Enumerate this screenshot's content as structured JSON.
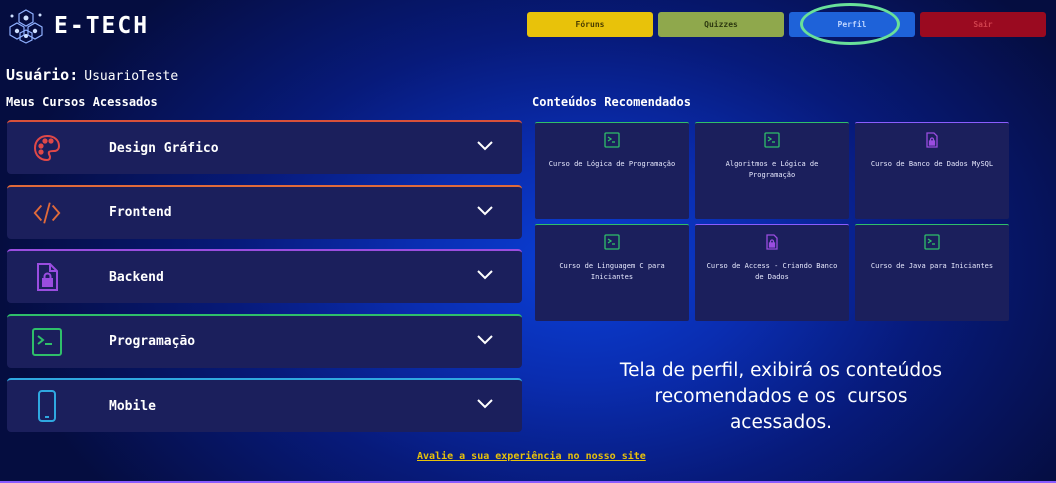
{
  "header": {
    "logo_text": "E-TECH",
    "logo_icon": "hexagon-network-icon",
    "nav": {
      "forums": "Fóruns",
      "quizzes": "Quizzes",
      "profile": "Perfil",
      "logout": "Sair"
    }
  },
  "user": {
    "label": "Usuário:",
    "name": "UsuarioTeste"
  },
  "courses_section": {
    "title": "Meus Cursos Acessados",
    "items": [
      {
        "label": "Design Gráfico",
        "icon": "palette-icon",
        "accent": "#e0503a"
      },
      {
        "label": "Frontend",
        "icon": "code-icon",
        "accent": "#e06a3a"
      },
      {
        "label": "Backend",
        "icon": "lock-file-icon",
        "accent": "#9a4de0"
      },
      {
        "label": "Programação",
        "icon": "terminal-icon",
        "accent": "#2fbf6a"
      },
      {
        "label": "Mobile",
        "icon": "smartphone-icon",
        "accent": "#2fa8e0"
      }
    ]
  },
  "recommended_section": {
    "title": "Conteúdos Recomendados",
    "items": [
      {
        "label": "Curso de Lógica de Programação",
        "icon": "terminal-icon"
      },
      {
        "label": "Algoritmos e Lógica de Programação",
        "icon": "terminal-icon"
      },
      {
        "label": "Curso de Banco de Dados MySQL",
        "icon": "lock-file-icon"
      },
      {
        "label": "Curso de Linguagem C para Iniciantes",
        "icon": "terminal-icon"
      },
      {
        "label": "Curso de Access - Criando Banco de Dados",
        "icon": "lock-file-icon"
      },
      {
        "label": "Curso de Java para Iniciantes",
        "icon": "terminal-icon"
      }
    ]
  },
  "caption": {
    "line1": "Tela de perfil, exibirá os conteúdos",
    "line2": "recomendados e os  cursos",
    "line3": "acessados."
  },
  "footer": {
    "feedback_link": "Avalie a sua experiência no nosso site"
  },
  "colors": {
    "forums": "#e8c20a",
    "quizzes": "#8fa84c",
    "profile": "#1e62d9",
    "logout": "#9a0a20",
    "highlight": "#69e09a"
  }
}
